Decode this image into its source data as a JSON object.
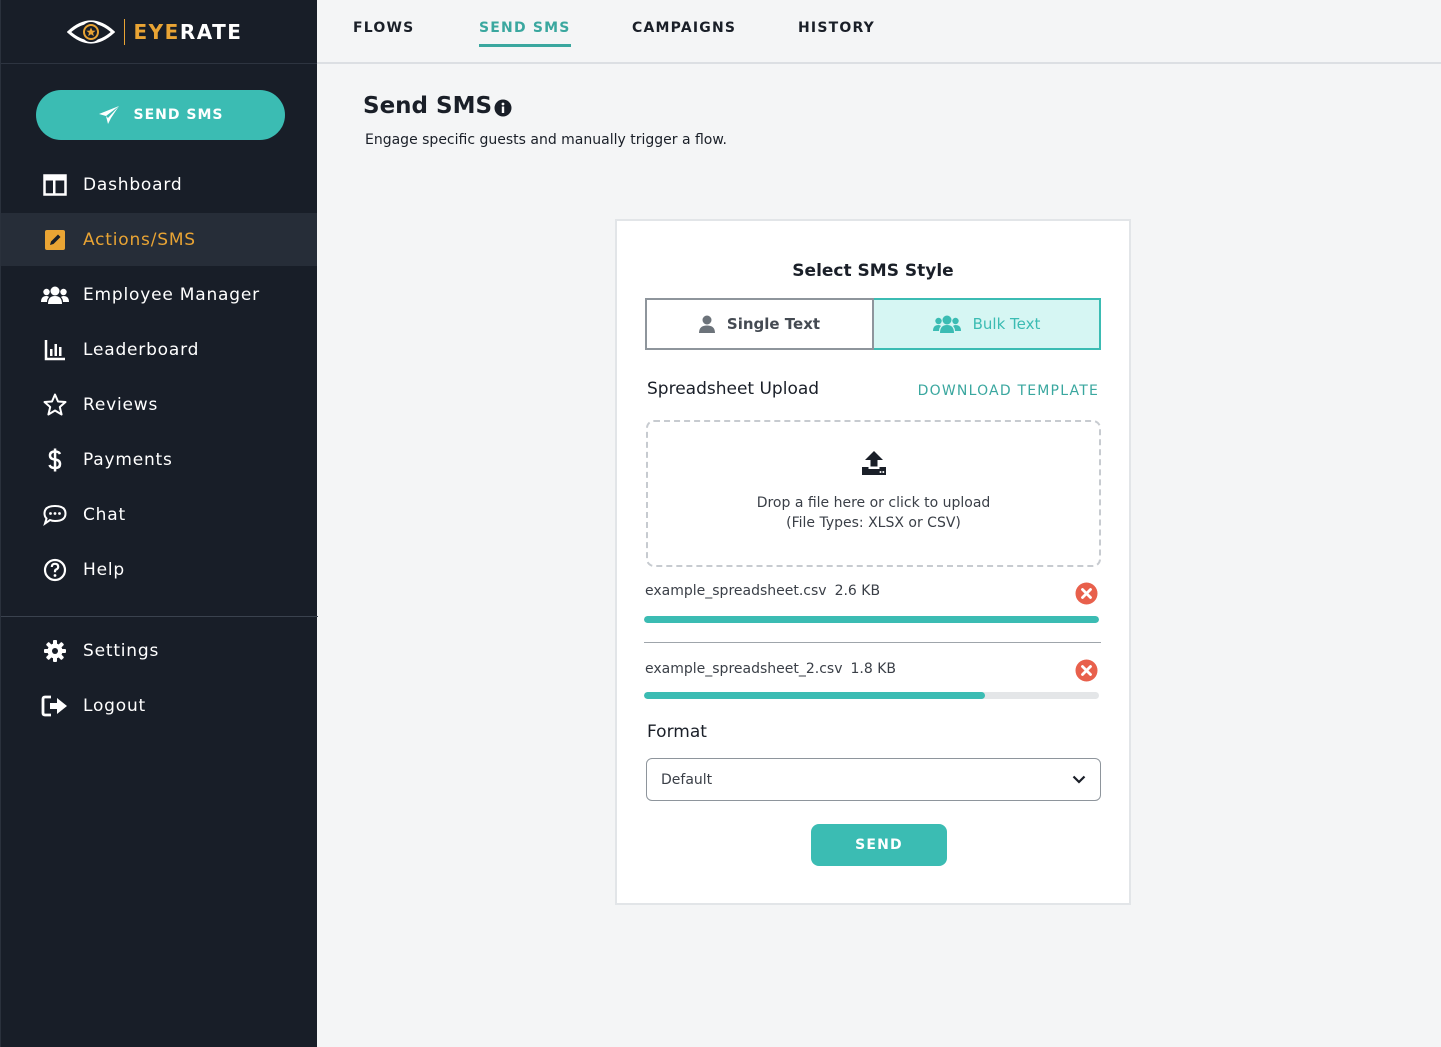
{
  "brand": {
    "eye": "EYE",
    "rate": "RATE"
  },
  "sidebar": {
    "send_button": "SEND SMS",
    "items": [
      {
        "label": "Dashboard",
        "icon": "dashboard-icon"
      },
      {
        "label": "Actions/SMS",
        "icon": "edit-icon",
        "active": true
      },
      {
        "label": "Employee Manager",
        "icon": "users-icon"
      },
      {
        "label": "Leaderboard",
        "icon": "leaderboard-icon"
      },
      {
        "label": "Reviews",
        "icon": "star-icon"
      },
      {
        "label": "Payments",
        "icon": "dollar-icon"
      },
      {
        "label": "Chat",
        "icon": "chat-icon"
      },
      {
        "label": "Help",
        "icon": "help-icon"
      }
    ],
    "bottom_items": [
      {
        "label": "Settings",
        "icon": "gear-icon"
      },
      {
        "label": "Logout",
        "icon": "logout-icon"
      }
    ]
  },
  "topnav": {
    "tabs": [
      {
        "label": "FLOWS"
      },
      {
        "label": "SEND SMS",
        "active": true
      },
      {
        "label": "CAMPAIGNS"
      },
      {
        "label": "HISTORY"
      }
    ]
  },
  "page": {
    "title": "Send SMS",
    "subtitle": "Engage specific guests and manually trigger a flow."
  },
  "card": {
    "title": "Select SMS Style",
    "options": {
      "single": "Single Text",
      "bulk": "Bulk Text",
      "selected": "bulk"
    },
    "upload_label": "Spreadsheet Upload",
    "download_link": "DOWNLOAD TEMPLATE",
    "dropzone": {
      "line1": "Drop a file here or click to upload",
      "line2": "(File Types: XLSX or CSV)"
    },
    "files": [
      {
        "name": "example_spreadsheet.csv",
        "size": "2.6 KB",
        "progress": 1.0
      },
      {
        "name": "example_spreadsheet_2.csv",
        "size": "1.8 KB",
        "progress": 0.75
      }
    ],
    "format_label": "Format",
    "format_value": "Default",
    "send_button": "SEND"
  },
  "colors": {
    "accent": "#3bbcb3",
    "brand": "#e9a434",
    "sidebar": "#181e28",
    "danger": "#e8604c"
  }
}
